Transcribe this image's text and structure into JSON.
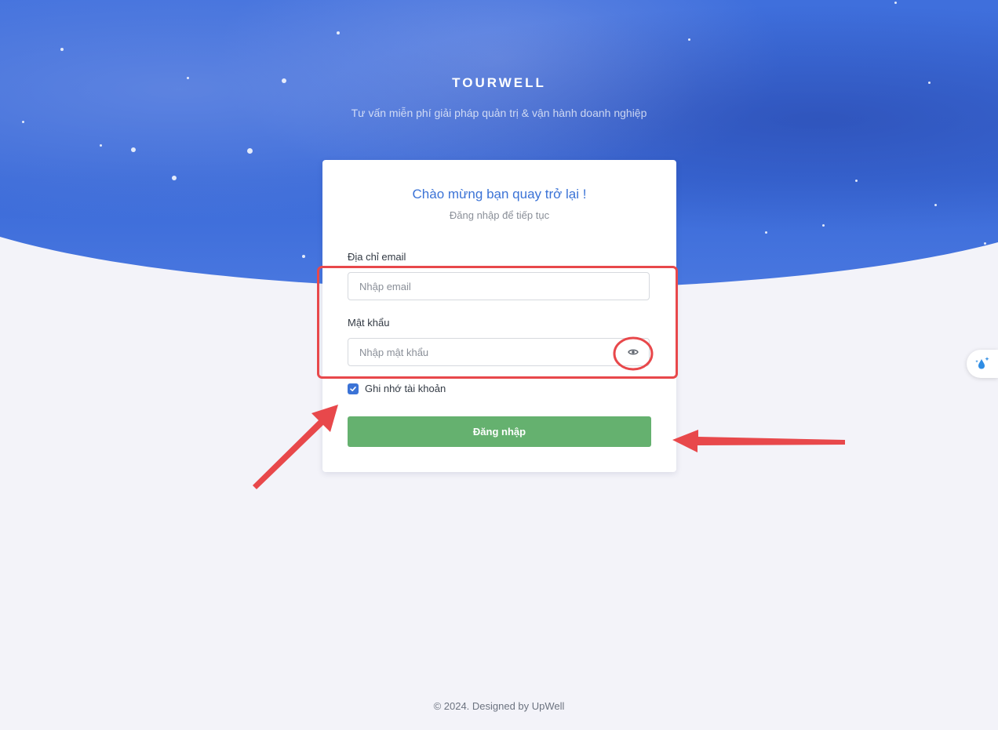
{
  "header": {
    "brand": "TOURWELL",
    "tagline": "Tư vấn miễn phí giải pháp quản trị & vận hành doanh nghiệp"
  },
  "login_card": {
    "title": "Chào mừng bạn quay trở lại !",
    "subtitle": "Đăng nhập để tiếp tục",
    "email_label": "Địa chỉ email",
    "email_placeholder": "Nhập email",
    "email_value": "",
    "password_label": "Mật khẩu",
    "password_placeholder": "Nhập mật khẩu",
    "password_value": "",
    "remember_label": "Ghi nhớ tài khoản",
    "remember_checked": true,
    "submit_label": "Đăng nhập"
  },
  "footer": {
    "copyright": "© 2024. Designed by UpWell"
  },
  "icons": {
    "password_toggle": "eye-icon",
    "side_widget": "water-drop-sparkle-icon",
    "checkbox": "checkmark-icon"
  },
  "colors": {
    "hero_blue": "#3f6fdc",
    "accent_blue": "#3b73d6",
    "button_green": "#65b16f",
    "page_background": "#f3f3f9",
    "annotation_red": "#e8484b"
  }
}
